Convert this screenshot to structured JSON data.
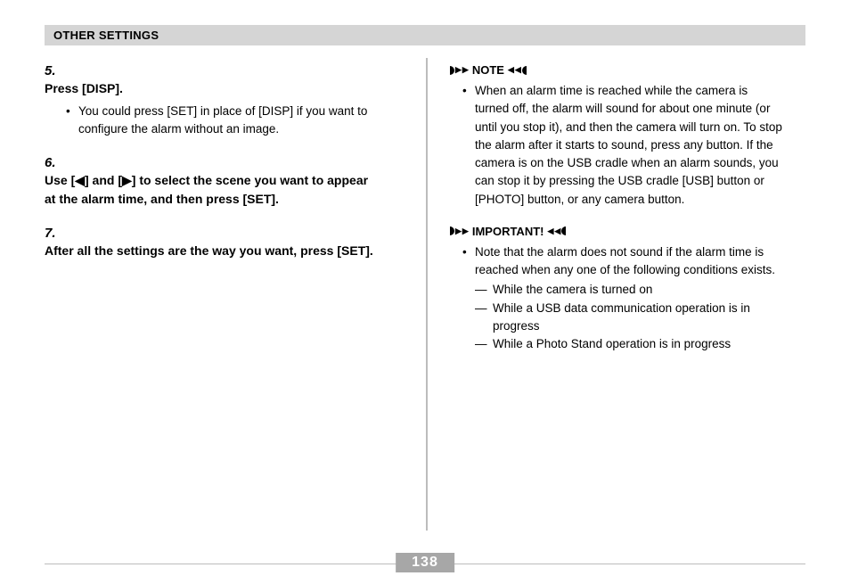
{
  "header": "OTHER SETTINGS",
  "steps": [
    {
      "num": "5.",
      "head": "Press [DISP].",
      "sub": "You could press [SET] in place of [DISP] if you want to configure the alarm without an image."
    },
    {
      "num": "6.",
      "head": "Use [◀] and [▶] to select the scene you want to appear at the alarm time, and then press [SET]."
    },
    {
      "num": "7.",
      "head": "After all the settings are the way you want, press [SET]."
    }
  ],
  "note": {
    "label": "NOTE",
    "body": "When an alarm time is reached while the camera is turned off, the alarm will sound for about one minute (or until you stop it), and then the camera will turn on. To stop the alarm after it starts to sound, press any button. If the camera is on the USB cradle when an alarm sounds, you can stop it by pressing the USB cradle [USB] button or [PHOTO] button, or any camera button."
  },
  "important": {
    "label": "IMPORTANT!",
    "intro": "Note that the alarm does not sound if the alarm time is reached when any one of the following conditions exists.",
    "items": [
      "While the camera is turned on",
      "While a USB data communication operation is in progress",
      "While a Photo Stand operation is in progress"
    ]
  },
  "page_number": "138"
}
